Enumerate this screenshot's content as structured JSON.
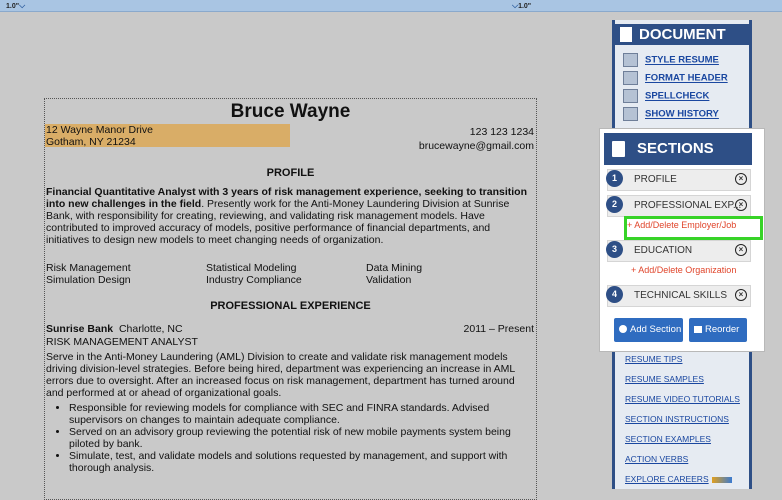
{
  "topbar": {
    "margin_left": "1.0\"",
    "margin_right": "1.0\""
  },
  "resume": {
    "name": "Bruce Wayne",
    "address_line1": "12 Wayne Manor Drive",
    "address_line2": "Gotham, NY 21234",
    "phone": "123 123 1234",
    "email": "brucewayne@gmail.com",
    "profile_heading": "PROFILE",
    "summary_bold": "Financial Quantitative Analyst with 3 years of risk management experience, seeking to transition into new challenges in the field",
    "summary_rest": ". Presently work for the Anti-Money Laundering Division at Sunrise Bank, with responsibility for creating, reviewing, and validating risk management models. Have contributed to improved accuracy of models, positive performance of financial departments, and initiatives to design new models to meet changing needs of organization.",
    "skills": [
      [
        "Risk Management",
        "Statistical Modeling",
        "Data Mining"
      ],
      [
        "Simulation Design",
        "Industry Compliance",
        "Validation"
      ]
    ],
    "experience_heading": "PROFESSIONAL EXPERIENCE",
    "job": {
      "company": "Sunrise Bank",
      "location": "Charlotte, NC",
      "dates": "2011 – Present",
      "title": "RISK MANAGEMENT ANALYST",
      "description": "Serve in the Anti-Money Laundering (AML) Division to create and validate risk management models driving division-level strategies. Before being hired, department was experiencing an increase in AML errors due to oversight. After an increased focus on risk management, department has turned around and performed at or ahead of organizational goals.",
      "bullets": [
        "Responsible for reviewing models for compliance with SEC and FINRA standards. Advised supervisors on changes to maintain adequate compliance.",
        "Served on an advisory group reviewing the potential risk of new mobile payments system being piloted by bank.",
        "Simulate, test, and validate models and solutions requested by management, and support with thorough analysis."
      ]
    }
  },
  "document_panel": {
    "title": "DOCUMENT",
    "links": [
      "STYLE RESUME",
      "FORMAT HEADER",
      "SPELLCHECK",
      "SHOW HISTORY"
    ],
    "bottom_links": [
      "RESUME TIPS",
      "RESUME SAMPLES",
      "RESUME VIDEO TUTORIALS",
      "SECTION INSTRUCTIONS",
      "SECTION EXAMPLES",
      "ACTION VERBS",
      "EXPLORE CAREERS"
    ]
  },
  "sections_panel": {
    "title": "SECTIONS",
    "items": [
      {
        "num": "1",
        "label": "PROFILE"
      },
      {
        "num": "2",
        "label": "PROFESSIONAL EXP..."
      },
      {
        "num": "3",
        "label": "EDUCATION"
      },
      {
        "num": "4",
        "label": "TECHNICAL SKILLS"
      }
    ],
    "add_employer": "+ Add/Delete Employer/Job",
    "add_organization": "+ Add/Delete Organization",
    "add_section_label": "Add Section",
    "reorder_label": "Reorder",
    "remove_symbol": "×"
  }
}
